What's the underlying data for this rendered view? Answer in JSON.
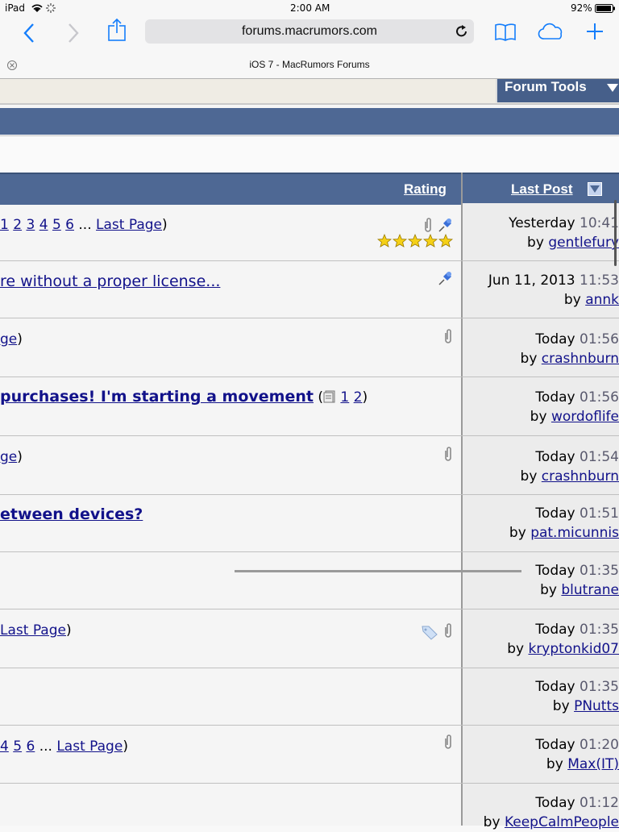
{
  "status": {
    "device": "iPad",
    "time": "2:00 AM",
    "battery": "92%"
  },
  "browser": {
    "url": "forums.macrumors.com",
    "tab_title": "iOS 7 - MacRumors Forums"
  },
  "toolbar": {
    "forum_tools": "Forum Tools"
  },
  "columns": {
    "rating": "Rating",
    "last_post": "Last Post"
  },
  "threads": [
    {
      "title_pre": "",
      "pages": [
        "1",
        "2",
        "3",
        "4",
        "5",
        "6"
      ],
      "ellipsis": " ... ",
      "last_page": "Last Page",
      "close": ")",
      "lp_when": "Yesterday",
      "lp_time": "10:41",
      "lp_by": "by",
      "lp_user": "gentlefury"
    },
    {
      "title_link": "re without a proper license...",
      "lp_when": "Jun 11, 2013",
      "lp_time": "11:53",
      "lp_by": "by",
      "lp_user": "annk"
    },
    {
      "title_link": "ge",
      "close": ")",
      "lp_when": "Today",
      "lp_time": "01:56",
      "lp_by": "by",
      "lp_user": "crashnburn"
    },
    {
      "title_link": " purchases! I'm starting a movement",
      "open": " (",
      "pages": [
        "1",
        "2"
      ],
      "close": ")",
      "lp_when": "Today",
      "lp_time": "01:56",
      "lp_by": "by",
      "lp_user": "wordoflife"
    },
    {
      "title_link": "ge",
      "close": ")",
      "lp_when": "Today",
      "lp_time": "01:54",
      "lp_by": "by",
      "lp_user": "crashnburn"
    },
    {
      "title_link": "etween devices?",
      "lp_when": "Today",
      "lp_time": "01:51",
      "lp_by": "by",
      "lp_user": "pat.micunnis"
    },
    {
      "lp_when": "Today",
      "lp_time": "01:35",
      "lp_by": "by",
      "lp_user": "blutrane"
    },
    {
      "last_page": "Last Page",
      "close": ")",
      "lp_when": "Today",
      "lp_time": "01:35",
      "lp_by": "by",
      "lp_user": "kryptonkid07"
    },
    {
      "lp_when": "Today",
      "lp_time": "01:35",
      "lp_by": "by",
      "lp_user": "PNutts"
    },
    {
      "pages": [
        "4",
        "5",
        "6"
      ],
      "ellipsis": " ... ",
      "last_page": "Last Page",
      "close": ")",
      "lp_when": "Today",
      "lp_time": "01:20",
      "lp_by": "by",
      "lp_user": "Max(IT)"
    },
    {
      "lp_when": "Today",
      "lp_time": "01:12",
      "lp_by": "by",
      "lp_user": "KeepCalmPeople"
    }
  ],
  "icons": {
    "attachment": "paperclip-icon",
    "sticky": "pushpin-icon",
    "tag": "tag-icon",
    "rating": "five-stars"
  },
  "colors": {
    "header_blue": "#4e6894",
    "link": "#12128a",
    "safari_blue": "#157efb"
  }
}
